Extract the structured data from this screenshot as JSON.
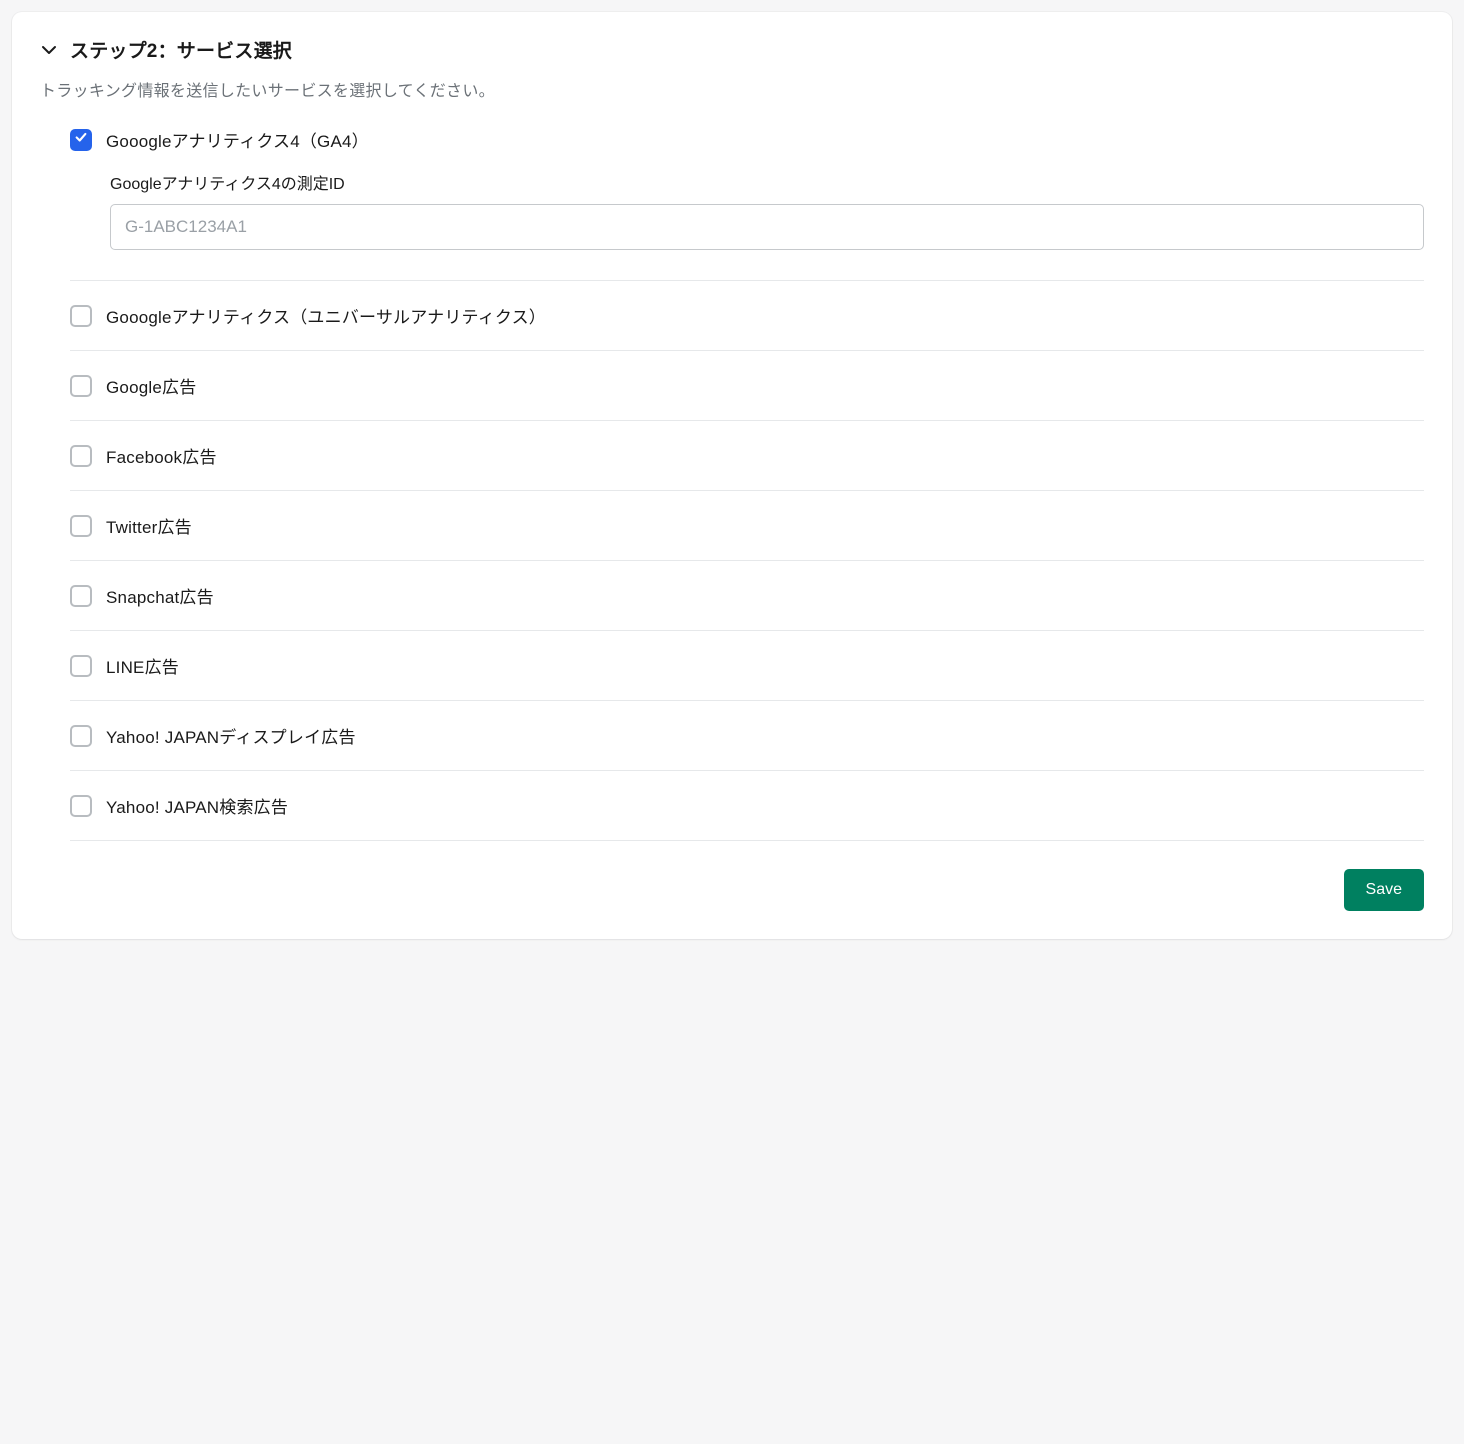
{
  "step": {
    "title": "ステップ2：サービス選択",
    "description": "トラッキング情報を送信したいサービスを選択してください。"
  },
  "services": [
    {
      "label": "Gooogleアナリティクス4（GA4）",
      "checked": true,
      "subField": {
        "label": "Googleアナリティクス4の測定ID",
        "placeholder": "G-1ABC1234A1",
        "value": ""
      }
    },
    {
      "label": "Gooogleアナリティクス（ユニバーサルアナリティクス）",
      "checked": false
    },
    {
      "label": "Google広告",
      "checked": false
    },
    {
      "label": "Facebook広告",
      "checked": false
    },
    {
      "label": "Twitter広告",
      "checked": false
    },
    {
      "label": "Snapchat広告",
      "checked": false
    },
    {
      "label": "LINE広告",
      "checked": false
    },
    {
      "label": "Yahoo! JAPANディスプレイ広告",
      "checked": false
    },
    {
      "label": "Yahoo! JAPAN検索広告",
      "checked": false
    }
  ],
  "actions": {
    "save_label": "Save"
  }
}
